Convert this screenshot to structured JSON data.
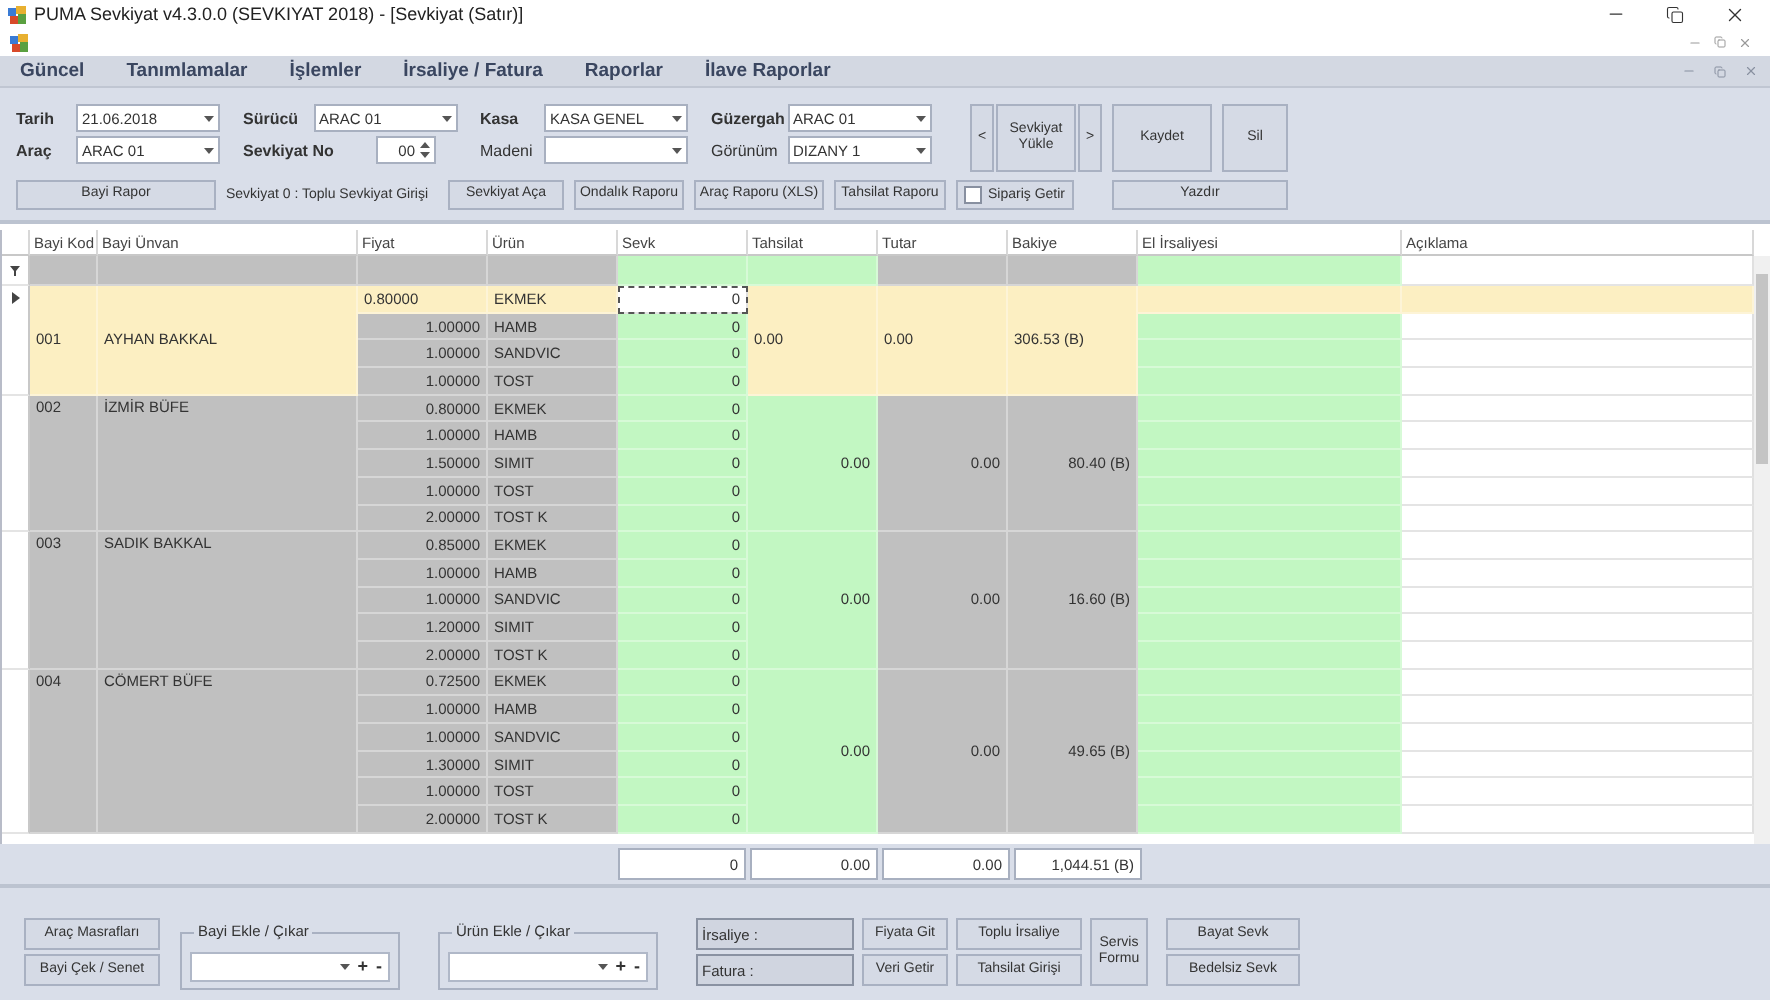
{
  "window": {
    "title": "PUMA Sevkiyat v4.3.0.0 (SEVKIYAT 2018) - [Sevkiyat (Satır)]"
  },
  "menu": [
    "Güncel",
    "Tanımlamalar",
    "İşlemler",
    "İrsaliye / Fatura",
    "Raporlar",
    "İlave Raporlar"
  ],
  "fields": [
    {
      "label": "Tarih",
      "value": "21.06.2018",
      "kind": "combo",
      "bold": true
    },
    {
      "label": "Sürücü",
      "value": "ARAC 01",
      "kind": "combo",
      "bold": true
    },
    {
      "label": "Kasa",
      "value": "KASA GENEL",
      "kind": "combo",
      "bold": true
    },
    {
      "label": "Güzergah",
      "value": "ARAC 01",
      "kind": "combo",
      "bold": true
    },
    {
      "label": "Araç",
      "value": "ARAC 01",
      "kind": "combo",
      "bold": true
    },
    {
      "label": "Sevkiyat No",
      "value": "00",
      "kind": "spin",
      "bold": true
    },
    {
      "label": "Madeni",
      "kind": "combo",
      "bold": false
    },
    {
      "label": "Görünüm",
      "value": "DIZANY 1",
      "kind": "combo",
      "bold": false
    }
  ],
  "action_row": {
    "report": "Bayi Rapor",
    "status": "Sevkiyat 0 : Toplu Sevkiyat Girişi",
    "buttons": [
      "Sevkiyat Aça",
      "Ondalık Raporu",
      "Araç Raporu (XLS)",
      "Tahsilat Raporu"
    ],
    "checkbox": {
      "label": "Sipariş Getir",
      "checked": false
    }
  },
  "nav": {
    "prev": "<",
    "load": "Sevkiyat Yükle",
    "next": ">"
  },
  "save": "Kaydet",
  "delete": "Sil",
  "print": "Yazdır",
  "table": {
    "columns": [
      "Bayi Kod",
      "Bayi Ünvan",
      "Fiyat",
      "Ürün",
      "Sevk",
      "Tahsilat",
      "Tutar",
      "Bakiye",
      "El İrsaliyesi",
      "Açıklama"
    ],
    "groups": [
      {
        "code": "001",
        "name": "AYHAN BAKKAL",
        "selected": true,
        "tahsilat": "0.00",
        "tutar": "0.00",
        "bakiye": "306.53 (B)",
        "items": [
          {
            "price": "0.80000",
            "product": "EKMEK",
            "sevk": "0"
          },
          {
            "price": "1.00000",
            "product": "HAMB",
            "sevk": "0"
          },
          {
            "price": "1.00000",
            "product": "SANDVIC",
            "sevk": "0"
          },
          {
            "price": "1.00000",
            "product": "TOST",
            "sevk": "0"
          }
        ]
      },
      {
        "code": "002",
        "name": "İZMİR BÜFE",
        "selected": false,
        "tahsilat": "0.00",
        "tutar": "0.00",
        "bakiye": "80.40 (B)",
        "items": [
          {
            "price": "0.80000",
            "product": "EKMEK",
            "sevk": "0"
          },
          {
            "price": "1.00000",
            "product": "HAMB",
            "sevk": "0"
          },
          {
            "price": "1.50000",
            "product": "SIMIT",
            "sevk": "0"
          },
          {
            "price": "1.00000",
            "product": "TOST",
            "sevk": "0"
          },
          {
            "price": "2.00000",
            "product": "TOST K",
            "sevk": "0"
          }
        ]
      },
      {
        "code": "003",
        "name": "SADIK BAKKAL",
        "selected": false,
        "tahsilat": "0.00",
        "tutar": "0.00",
        "bakiye": "16.60 (B)",
        "items": [
          {
            "price": "0.85000",
            "product": "EKMEK",
            "sevk": "0"
          },
          {
            "price": "1.00000",
            "product": "HAMB",
            "sevk": "0"
          },
          {
            "price": "1.00000",
            "product": "SANDVIC",
            "sevk": "0"
          },
          {
            "price": "1.20000",
            "product": "SIMIT",
            "sevk": "0"
          },
          {
            "price": "2.00000",
            "product": "TOST K",
            "sevk": "0"
          }
        ]
      },
      {
        "code": "004",
        "name": "CÖMERT BÜFE",
        "selected": false,
        "tahsilat": "0.00",
        "tutar": "0.00",
        "bakiye": "49.65 (B)",
        "items": [
          {
            "price": "0.72500",
            "product": "EKMEK",
            "sevk": "0"
          },
          {
            "price": "1.00000",
            "product": "HAMB",
            "sevk": "0"
          },
          {
            "price": "1.00000",
            "product": "SANDVIC",
            "sevk": "0"
          },
          {
            "price": "1.30000",
            "product": "SIMIT",
            "sevk": "0"
          },
          {
            "price": "1.00000",
            "product": "TOST",
            "sevk": "0"
          },
          {
            "price": "2.00000",
            "product": "TOST K",
            "sevk": "0"
          }
        ]
      }
    ],
    "totals": [
      "0",
      "0.00",
      "0.00",
      "1,044.51 (B)"
    ]
  },
  "side_buttons": [
    "Araç Masrafları",
    "Bayi Çek / Senet"
  ],
  "pickers": [
    {
      "title": "Bayi Ekle / Çıkar",
      "add": "+",
      "remove": "-"
    },
    {
      "title": "Ürün Ekle / Çıkar",
      "add": "+",
      "remove": "-"
    }
  ],
  "documents": [
    "İrsaliye :",
    "Fatura :"
  ],
  "button_columns": [
    [
      "Fiyata Git",
      "Veri Getir"
    ],
    [
      "Toplu İrsaliye",
      "Tahsilat Girişi"
    ],
    [
      "Servis Formu"
    ],
    [
      "Bayat Sevk",
      "Bedelsiz Sevk"
    ]
  ]
}
